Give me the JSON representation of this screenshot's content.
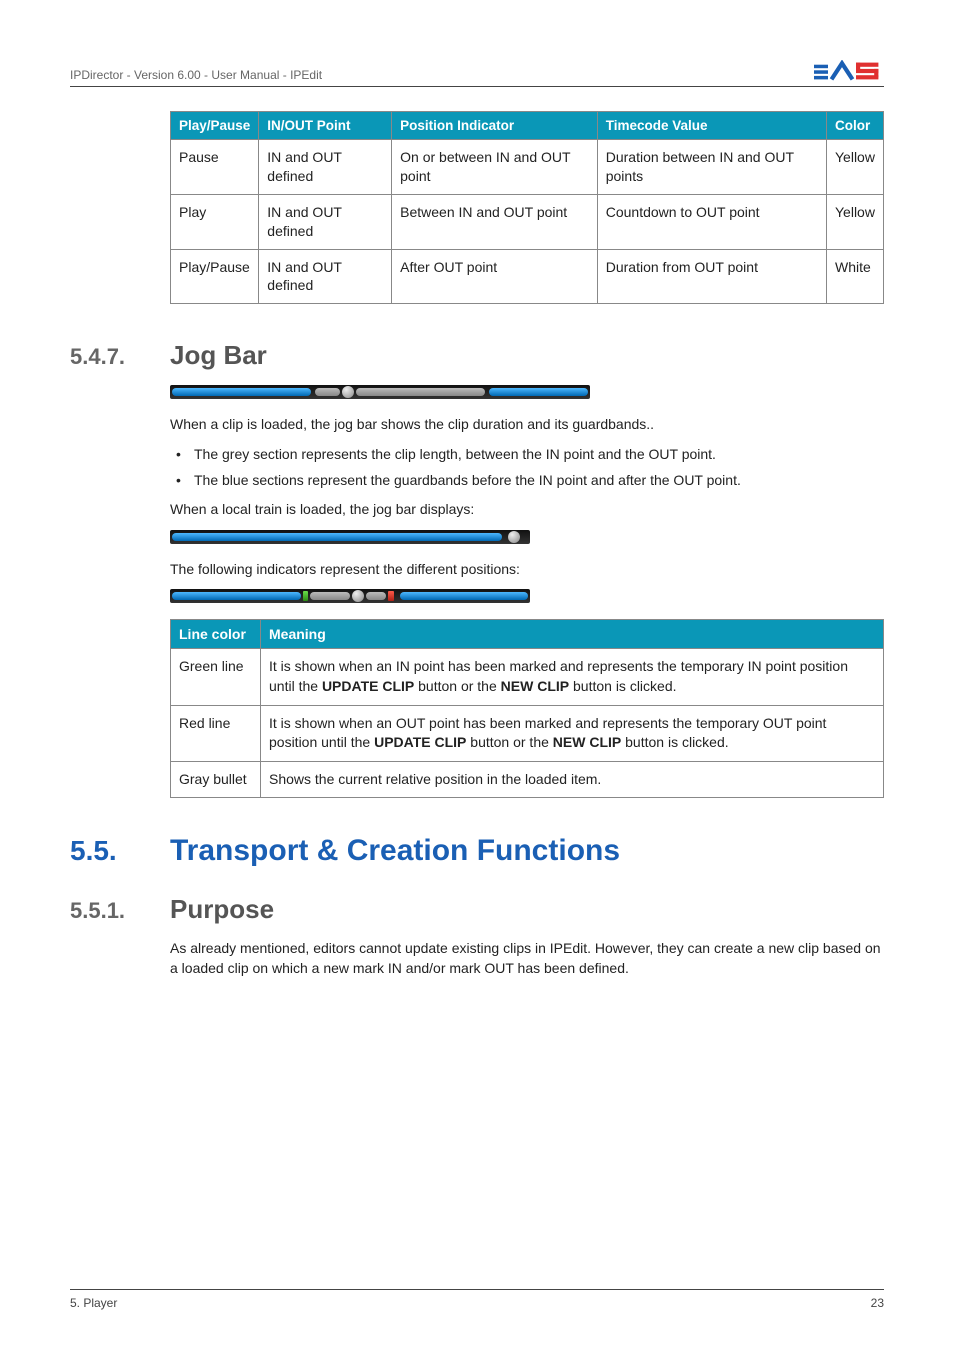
{
  "header": {
    "text": "IPDirector - Version 6.00 - User Manual - IPEdit"
  },
  "table1": {
    "headers": [
      "Play/Pause",
      "IN/OUT Point",
      "Position Indicator",
      "Timecode Value",
      "Color"
    ],
    "rows": [
      [
        "Pause",
        "IN and OUT defined",
        "On or between IN and OUT point",
        "Duration between IN and OUT points",
        "Yellow"
      ],
      [
        "Play",
        "IN and OUT defined",
        "Between IN and OUT point",
        "Countdown to OUT point",
        "Yellow"
      ],
      [
        "Play/Pause",
        "IN and OUT defined",
        "After OUT point",
        "Duration from OUT point",
        "White"
      ]
    ]
  },
  "sec547": {
    "num": "5.4.7.",
    "title": "Jog Bar"
  },
  "jog": {
    "p1": "When a clip is loaded, the jog bar shows the clip duration and its guardbands..",
    "b1": "The grey section represents the clip length, between the IN point and the OUT point.",
    "b2": "The blue sections represent the guardbands before the IN point and after the OUT point.",
    "p2": "When a local train is loaded, the jog bar displays:",
    "p3": "The following indicators represent the different positions:"
  },
  "table2": {
    "headers": [
      "Line color",
      "Meaning"
    ],
    "rows": [
      {
        "c0": "Green line",
        "pre": "It is shown when an IN point has been marked and represents the temporary IN point position until the ",
        "b1": "UPDATE CLIP",
        "mid": " button or the ",
        "b2": "NEW CLIP",
        "post": " button is clicked."
      },
      {
        "c0": "Red line",
        "pre": "It is shown when an OUT point has been marked and represents the temporary OUT point position until the ",
        "b1": "UPDATE CLIP",
        "mid": " button or the ",
        "b2": "NEW CLIP",
        "post": " button is clicked."
      },
      {
        "c0": "Gray bullet",
        "plain": "Shows the current relative position in the loaded item."
      }
    ]
  },
  "sec55": {
    "num": "5.5.",
    "title": "Transport & Creation Functions"
  },
  "sec551": {
    "num": "5.5.1.",
    "title": "Purpose"
  },
  "purpose": {
    "p1": "As already mentioned, editors cannot update existing clips in IPEdit. However, they can create a new clip based on a loaded clip on which a new mark IN and/or mark OUT has been defined."
  },
  "footer": {
    "left": "5. Player",
    "right": "23"
  }
}
